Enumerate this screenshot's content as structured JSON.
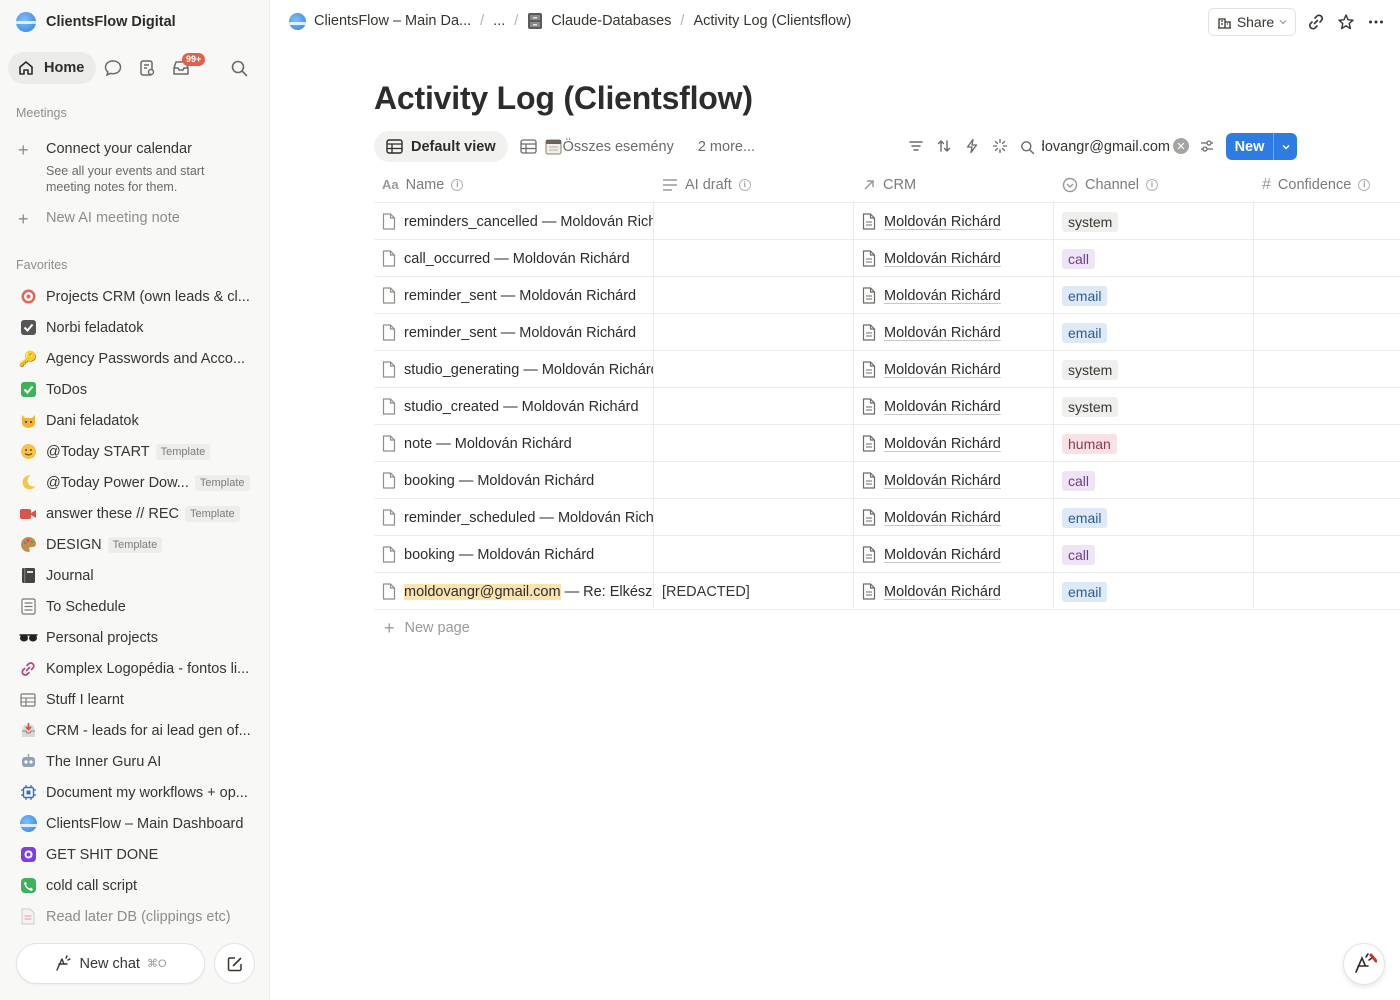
{
  "workspace": {
    "name": "ClientsFlow Digital"
  },
  "nav": {
    "home": "Home",
    "inbox_badge": "99+"
  },
  "meetings": {
    "title": "Meetings",
    "connect_title": "Connect your calendar",
    "connect_desc": "See all your events and start meeting notes for them.",
    "new_ai_note": "New AI meeting note"
  },
  "favorites": {
    "title": "Favorites",
    "items": [
      {
        "label": "Projects CRM (own leads & cl...",
        "icon": "target-icon",
        "template": ""
      },
      {
        "label": "Norbi feladatok",
        "icon": "checkbox-icon",
        "template": ""
      },
      {
        "label": "Agency Passwords and Acco...",
        "icon": "key-icon",
        "template": ""
      },
      {
        "label": "ToDos",
        "icon": "check-mark-icon",
        "template": ""
      },
      {
        "label": "Dani feladatok",
        "icon": "cat-icon",
        "template": ""
      },
      {
        "label": "@Today START",
        "icon": "smile-icon",
        "template": "Template"
      },
      {
        "label": "@Today Power Dow...",
        "icon": "moon-icon",
        "template": "Template"
      },
      {
        "label": "answer these // REC",
        "icon": "video-camera-icon",
        "template": "Template"
      },
      {
        "label": "DESIGN",
        "icon": "palette-icon",
        "template": "Template"
      },
      {
        "label": "Journal",
        "icon": "notebook-icon",
        "template": ""
      },
      {
        "label": "To Schedule",
        "icon": "list-icon",
        "template": ""
      },
      {
        "label": "Personal projects",
        "icon": "sunglasses-icon",
        "template": ""
      },
      {
        "label": "Komplex Logopédia - fontos li...",
        "icon": "link-icon",
        "template": ""
      },
      {
        "label": "Stuff I learnt",
        "icon": "table-icon",
        "template": ""
      },
      {
        "label": "CRM - leads for ai lead gen of...",
        "icon": "inbox-tray-icon",
        "template": ""
      },
      {
        "label": "The Inner Guru AI",
        "icon": "robot-icon",
        "template": ""
      },
      {
        "label": "Document my workflows + op...",
        "icon": "chip-icon",
        "template": ""
      },
      {
        "label": "ClientsFlow – Main Dashboard",
        "icon": "globe-icon",
        "template": ""
      },
      {
        "label": "GET SHIT DONE",
        "icon": "purple-badge-icon",
        "template": ""
      },
      {
        "label": "cold call script",
        "icon": "phone-icon",
        "template": ""
      },
      {
        "label": "Read later DB (clippings etc)",
        "icon": "document-icon",
        "template": ""
      }
    ]
  },
  "new_chat": {
    "label": "New chat",
    "shortcut": "⌘O"
  },
  "breadcrumbs": {
    "root": "ClientsFlow – Main Da...",
    "ellipsis": "...",
    "parent": "Claude-Databases",
    "current": "Activity Log (Clientsflow)"
  },
  "topbar": {
    "share": "Share"
  },
  "page": {
    "title": "Activity Log (Clientsflow)"
  },
  "views": {
    "default": "Default view",
    "second": "Összes esemény",
    "more": "2 more..."
  },
  "search": {
    "value": "moldovangr@gmail.com"
  },
  "new_button": "New",
  "columns": {
    "name": "Name",
    "ai_draft": "AI draft",
    "crm": "CRM",
    "channel": "Channel",
    "confidence": "Confidence"
  },
  "rows": [
    {
      "name": "reminders_cancelled — Moldován Richárd",
      "highlight": "",
      "ai_draft": "",
      "crm": "Moldován Richárd",
      "channel": "system"
    },
    {
      "name": "call_occurred — Moldován Richárd",
      "highlight": "",
      "ai_draft": "",
      "crm": "Moldován Richárd",
      "channel": "call"
    },
    {
      "name": "reminder_sent — Moldován Richárd",
      "highlight": "",
      "ai_draft": "",
      "crm": "Moldován Richárd",
      "channel": "email"
    },
    {
      "name": "reminder_sent — Moldován Richárd",
      "highlight": "",
      "ai_draft": "",
      "crm": "Moldován Richárd",
      "channel": "email"
    },
    {
      "name": "studio_generating — Moldován Richárd",
      "highlight": "",
      "ai_draft": "",
      "crm": "Moldován Richárd",
      "channel": "system"
    },
    {
      "name": "studio_created — Moldován Richárd",
      "highlight": "",
      "ai_draft": "",
      "crm": "Moldován Richárd",
      "channel": "system"
    },
    {
      "name": "note — Moldován Richárd",
      "highlight": "",
      "ai_draft": "",
      "crm": "Moldován Richárd",
      "channel": "human"
    },
    {
      "name": "booking — Moldován Richárd",
      "highlight": "",
      "ai_draft": "",
      "crm": "Moldován Richárd",
      "channel": "call"
    },
    {
      "name": "reminder_scheduled — Moldován Richárd",
      "highlight": "",
      "ai_draft": "",
      "crm": "Moldován Richárd",
      "channel": "email"
    },
    {
      "name": "booking — Moldován Richárd",
      "highlight": "",
      "ai_draft": "",
      "crm": "Moldován Richárd",
      "channel": "call"
    },
    {
      "name": " — Re: Elkészült",
      "highlight": "moldovangr@gmail.com",
      "ai_draft": "[REDACTED]",
      "crm": "Moldován Richárd",
      "channel": "email"
    }
  ],
  "channel_colors": {
    "system": {
      "bg": "#efefed",
      "fg": "#37352f"
    },
    "call": {
      "bg": "#efe4f5",
      "fg": "#6b3f8a"
    },
    "email": {
      "bg": "#dde9f7",
      "fg": "#2b5c8f"
    },
    "human": {
      "bg": "#f9e1e6",
      "fg": "#8f3a4e"
    }
  },
  "new_page": "New page"
}
